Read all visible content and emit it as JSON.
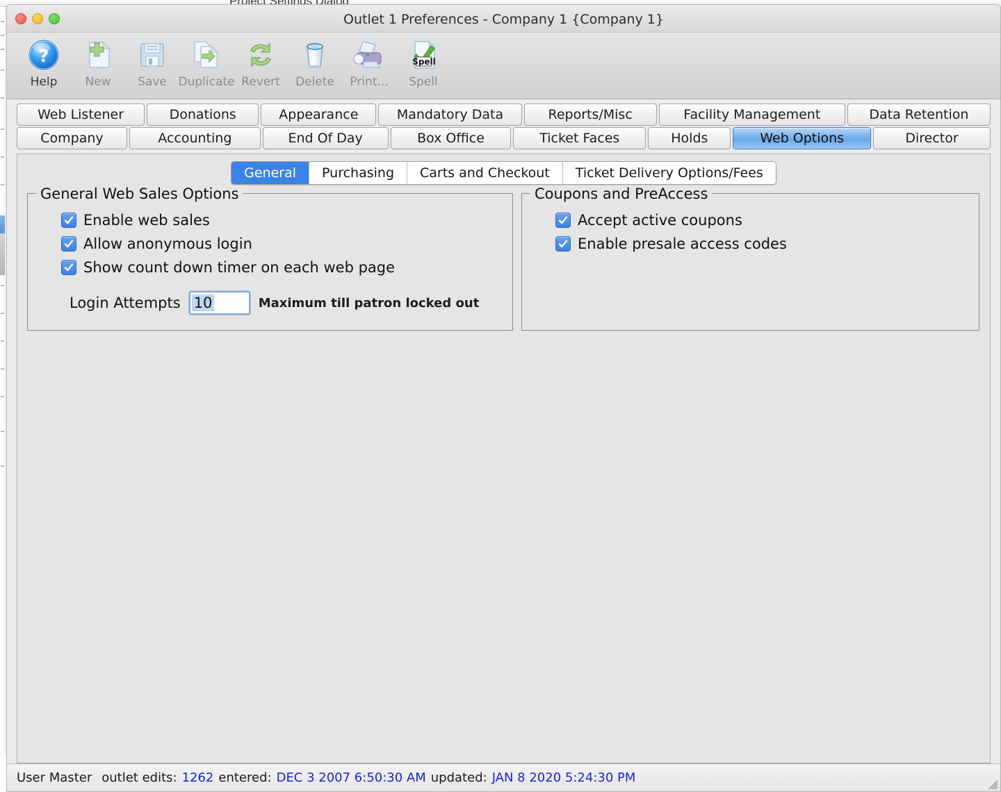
{
  "background": {
    "obscured_window_title": "Project Settings Dialog"
  },
  "window": {
    "title": "Outlet 1 Preferences - Company 1 {Company 1}",
    "traffic_lights": [
      {
        "name": "close",
        "color": "#e8554c"
      },
      {
        "name": "minimize",
        "color": "#f0b418"
      },
      {
        "name": "maximize",
        "color": "#42bf33"
      }
    ]
  },
  "toolbar": {
    "buttons": [
      {
        "label": "Help",
        "icon": "help-icon",
        "enabled": true
      },
      {
        "label": "New",
        "icon": "new-icon",
        "enabled": false
      },
      {
        "label": "Save",
        "icon": "save-icon",
        "enabled": false
      },
      {
        "label": "Duplicate",
        "icon": "duplicate-icon",
        "enabled": false
      },
      {
        "label": "Revert",
        "icon": "revert-icon",
        "enabled": false
      },
      {
        "label": "Delete",
        "icon": "delete-icon",
        "enabled": false
      },
      {
        "label": "Print...",
        "icon": "print-icon",
        "enabled": false
      },
      {
        "label": "Spell",
        "icon": "spell-icon",
        "enabled": false
      }
    ]
  },
  "tabs": {
    "row1": [
      {
        "label": "Web Listener",
        "selected": false
      },
      {
        "label": "Donations",
        "selected": false
      },
      {
        "label": "Appearance",
        "selected": false
      },
      {
        "label": "Mandatory Data",
        "selected": false
      },
      {
        "label": "Reports/Misc",
        "selected": false
      },
      {
        "label": "Facility Management",
        "selected": false
      },
      {
        "label": "Data Retention",
        "selected": false
      }
    ],
    "row2": [
      {
        "label": "Company",
        "selected": false
      },
      {
        "label": "Accounting",
        "selected": false
      },
      {
        "label": "End Of Day",
        "selected": false
      },
      {
        "label": "Box Office",
        "selected": false
      },
      {
        "label": "Ticket Faces",
        "selected": false
      },
      {
        "label": "Holds",
        "selected": false
      },
      {
        "label": "Web Options",
        "selected": true
      },
      {
        "label": "Director",
        "selected": false
      }
    ]
  },
  "subtabs": [
    {
      "label": "General",
      "selected": true
    },
    {
      "label": "Purchasing",
      "selected": false
    },
    {
      "label": "Carts and Checkout",
      "selected": false
    },
    {
      "label": "Ticket Delivery Options/Fees",
      "selected": false
    }
  ],
  "groups": {
    "general_web_sales": {
      "title": "General Web Sales Options",
      "checkboxes": [
        {
          "label": "Enable web sales",
          "checked": true
        },
        {
          "label": "Allow anonymous login",
          "checked": true
        },
        {
          "label": "Show count down timer on each web page",
          "checked": true
        }
      ],
      "login_attempts": {
        "label": "Login Attempts",
        "value": "10",
        "hint": "Maximum till patron locked out"
      }
    },
    "coupons_preaccess": {
      "title": "Coupons and PreAccess",
      "checkboxes": [
        {
          "label": "Accept active coupons",
          "checked": true
        },
        {
          "label": "Enable presale access codes",
          "checked": true
        }
      ]
    }
  },
  "status_bar": {
    "user": "User Master",
    "edits_label": "outlet edits:",
    "edits_value": "1262",
    "entered_label": "entered:",
    "entered_value": "DEC 3 2007 6:50:30 AM",
    "updated_label": "updated:",
    "updated_value": "JAN 8 2020 5:24:30 PM"
  },
  "colors": {
    "accent_blue": "#3b82e6",
    "selected_tab": "#6aa7e8",
    "link_blue": "#1826d6",
    "window_bg": "#ececec",
    "panel_bg": "#e5e5e5"
  }
}
